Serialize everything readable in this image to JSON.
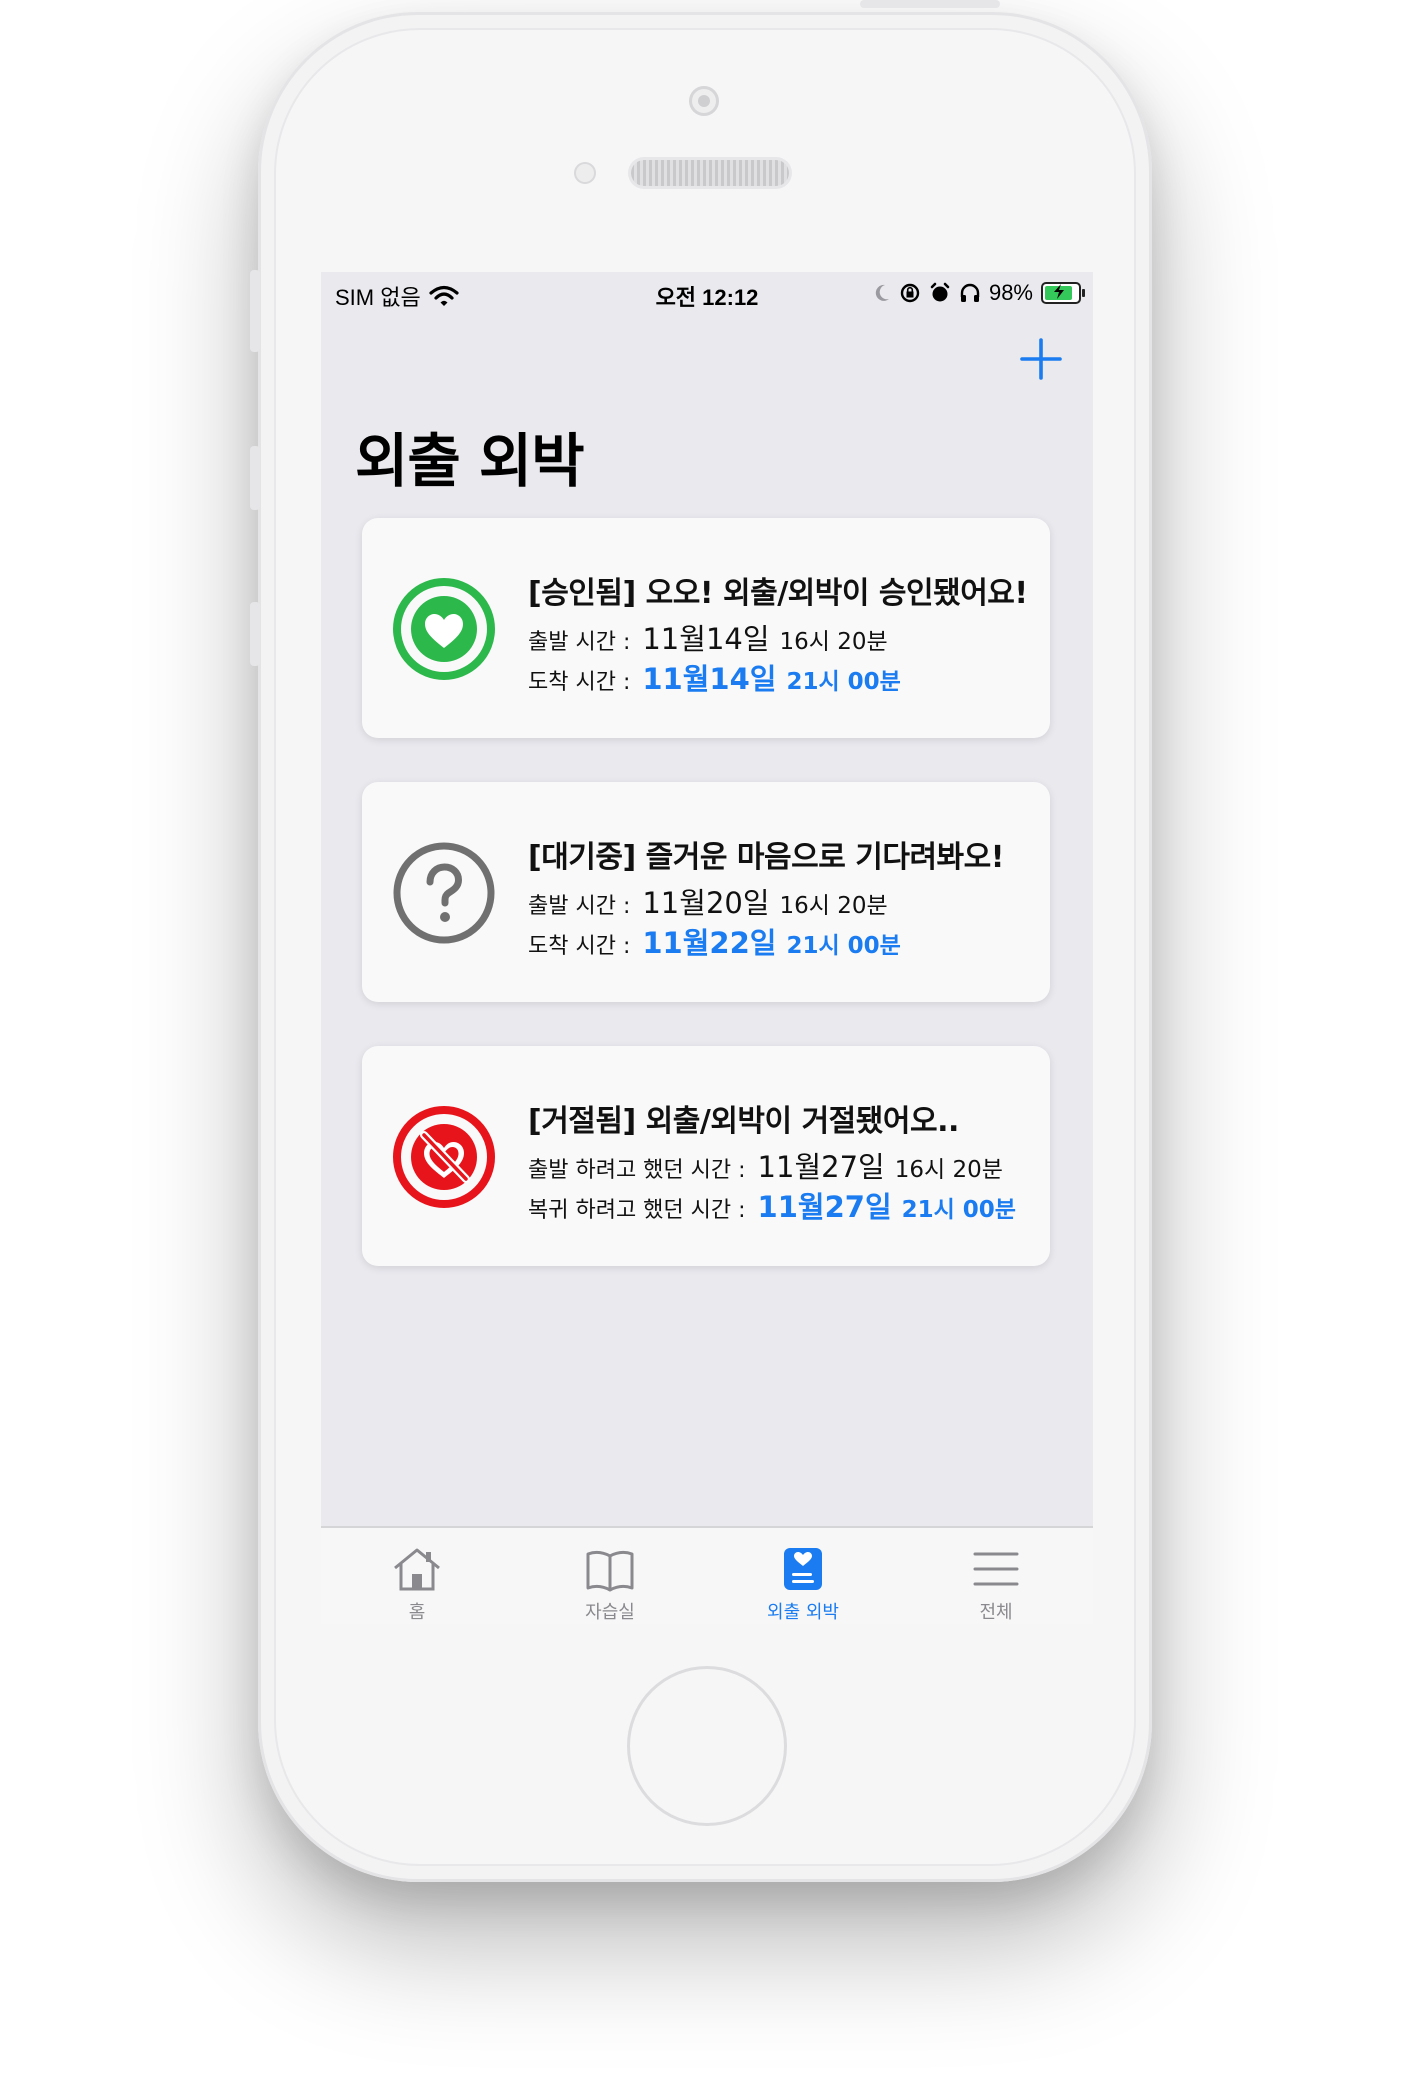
{
  "status_bar": {
    "carrier": "SIM 없음",
    "time": "오전 12:12",
    "battery": "98%",
    "battery_level": 0.98
  },
  "header": {
    "add_icon": "plus-icon",
    "title": "외출 외박"
  },
  "cards": [
    {
      "icon": "heart-approved-icon",
      "status_color": "#2db84b",
      "title": "[승인됨] 오오! 외출/외박이 승인됐어요!",
      "depart_label": "출발 시간 :",
      "depart_date": "11월14일",
      "depart_time": "16시 20분",
      "arrive_label": "도착 시간 :",
      "arrive_date": "11월14일",
      "arrive_time": "21시 00분"
    },
    {
      "icon": "question-pending-icon",
      "status_color": "#707070",
      "title": "[대기중] 즐거운 마음으로 기다려봐오!",
      "depart_label": "출발 시간 :",
      "depart_date": "11월20일",
      "depart_time": "16시 20분",
      "arrive_label": "도착 시간 :",
      "arrive_date": "11월22일",
      "arrive_time": "21시 00분"
    },
    {
      "icon": "heart-rejected-icon",
      "status_color": "#e8141b",
      "title": "[거절됨] 외출/외박이 거절됐어오..",
      "depart_label": "출발 하려고 했던 시간 :",
      "depart_date": "11월27일",
      "depart_time": "16시 20분",
      "arrive_label": "복귀 하려고 했던 시간 :",
      "arrive_date": "11월27일",
      "arrive_time": "21시 00분"
    }
  ],
  "tabbar": {
    "tabs": [
      {
        "label": "홈",
        "icon": "home-icon"
      },
      {
        "label": "자습실",
        "icon": "book-icon"
      },
      {
        "label": "외출 외박",
        "icon": "outing-icon",
        "active": true
      },
      {
        "label": "전체",
        "icon": "menu-icon"
      }
    ]
  },
  "colors": {
    "accent": "#1a7cf0",
    "background": "#e9e9ee"
  }
}
